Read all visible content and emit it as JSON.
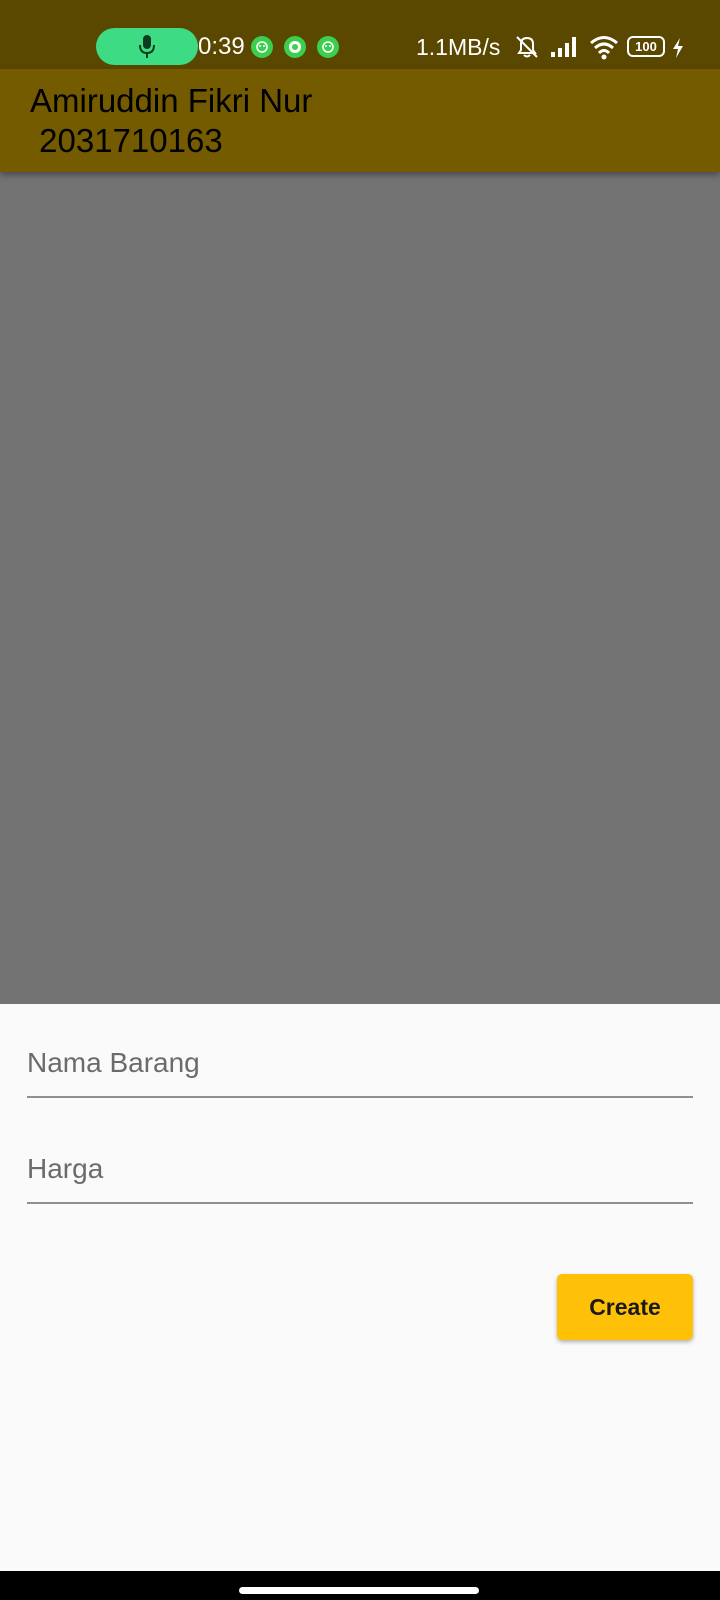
{
  "status_bar": {
    "time": "0:39",
    "network_speed": "1.1MB/s",
    "battery_level": "100",
    "icons": [
      "mic-icon",
      "notification-app-icon",
      "whatsapp-icon",
      "notification-app-icon",
      "bell-off-icon",
      "signal-icon",
      "wifi-icon",
      "battery-icon",
      "charging-icon"
    ],
    "colors": {
      "mic_pill": "#3ddc84",
      "notif": "#3ccf4e"
    }
  },
  "app_bar": {
    "title": "Amiruddin Fikri Nur\n 2031710163",
    "color": "#745b00"
  },
  "form": {
    "name_field": {
      "placeholder": "Nama Barang",
      "value": ""
    },
    "price_field": {
      "placeholder": "Harga",
      "value": ""
    },
    "create_label": "Create",
    "button_color": "#ffc107"
  }
}
